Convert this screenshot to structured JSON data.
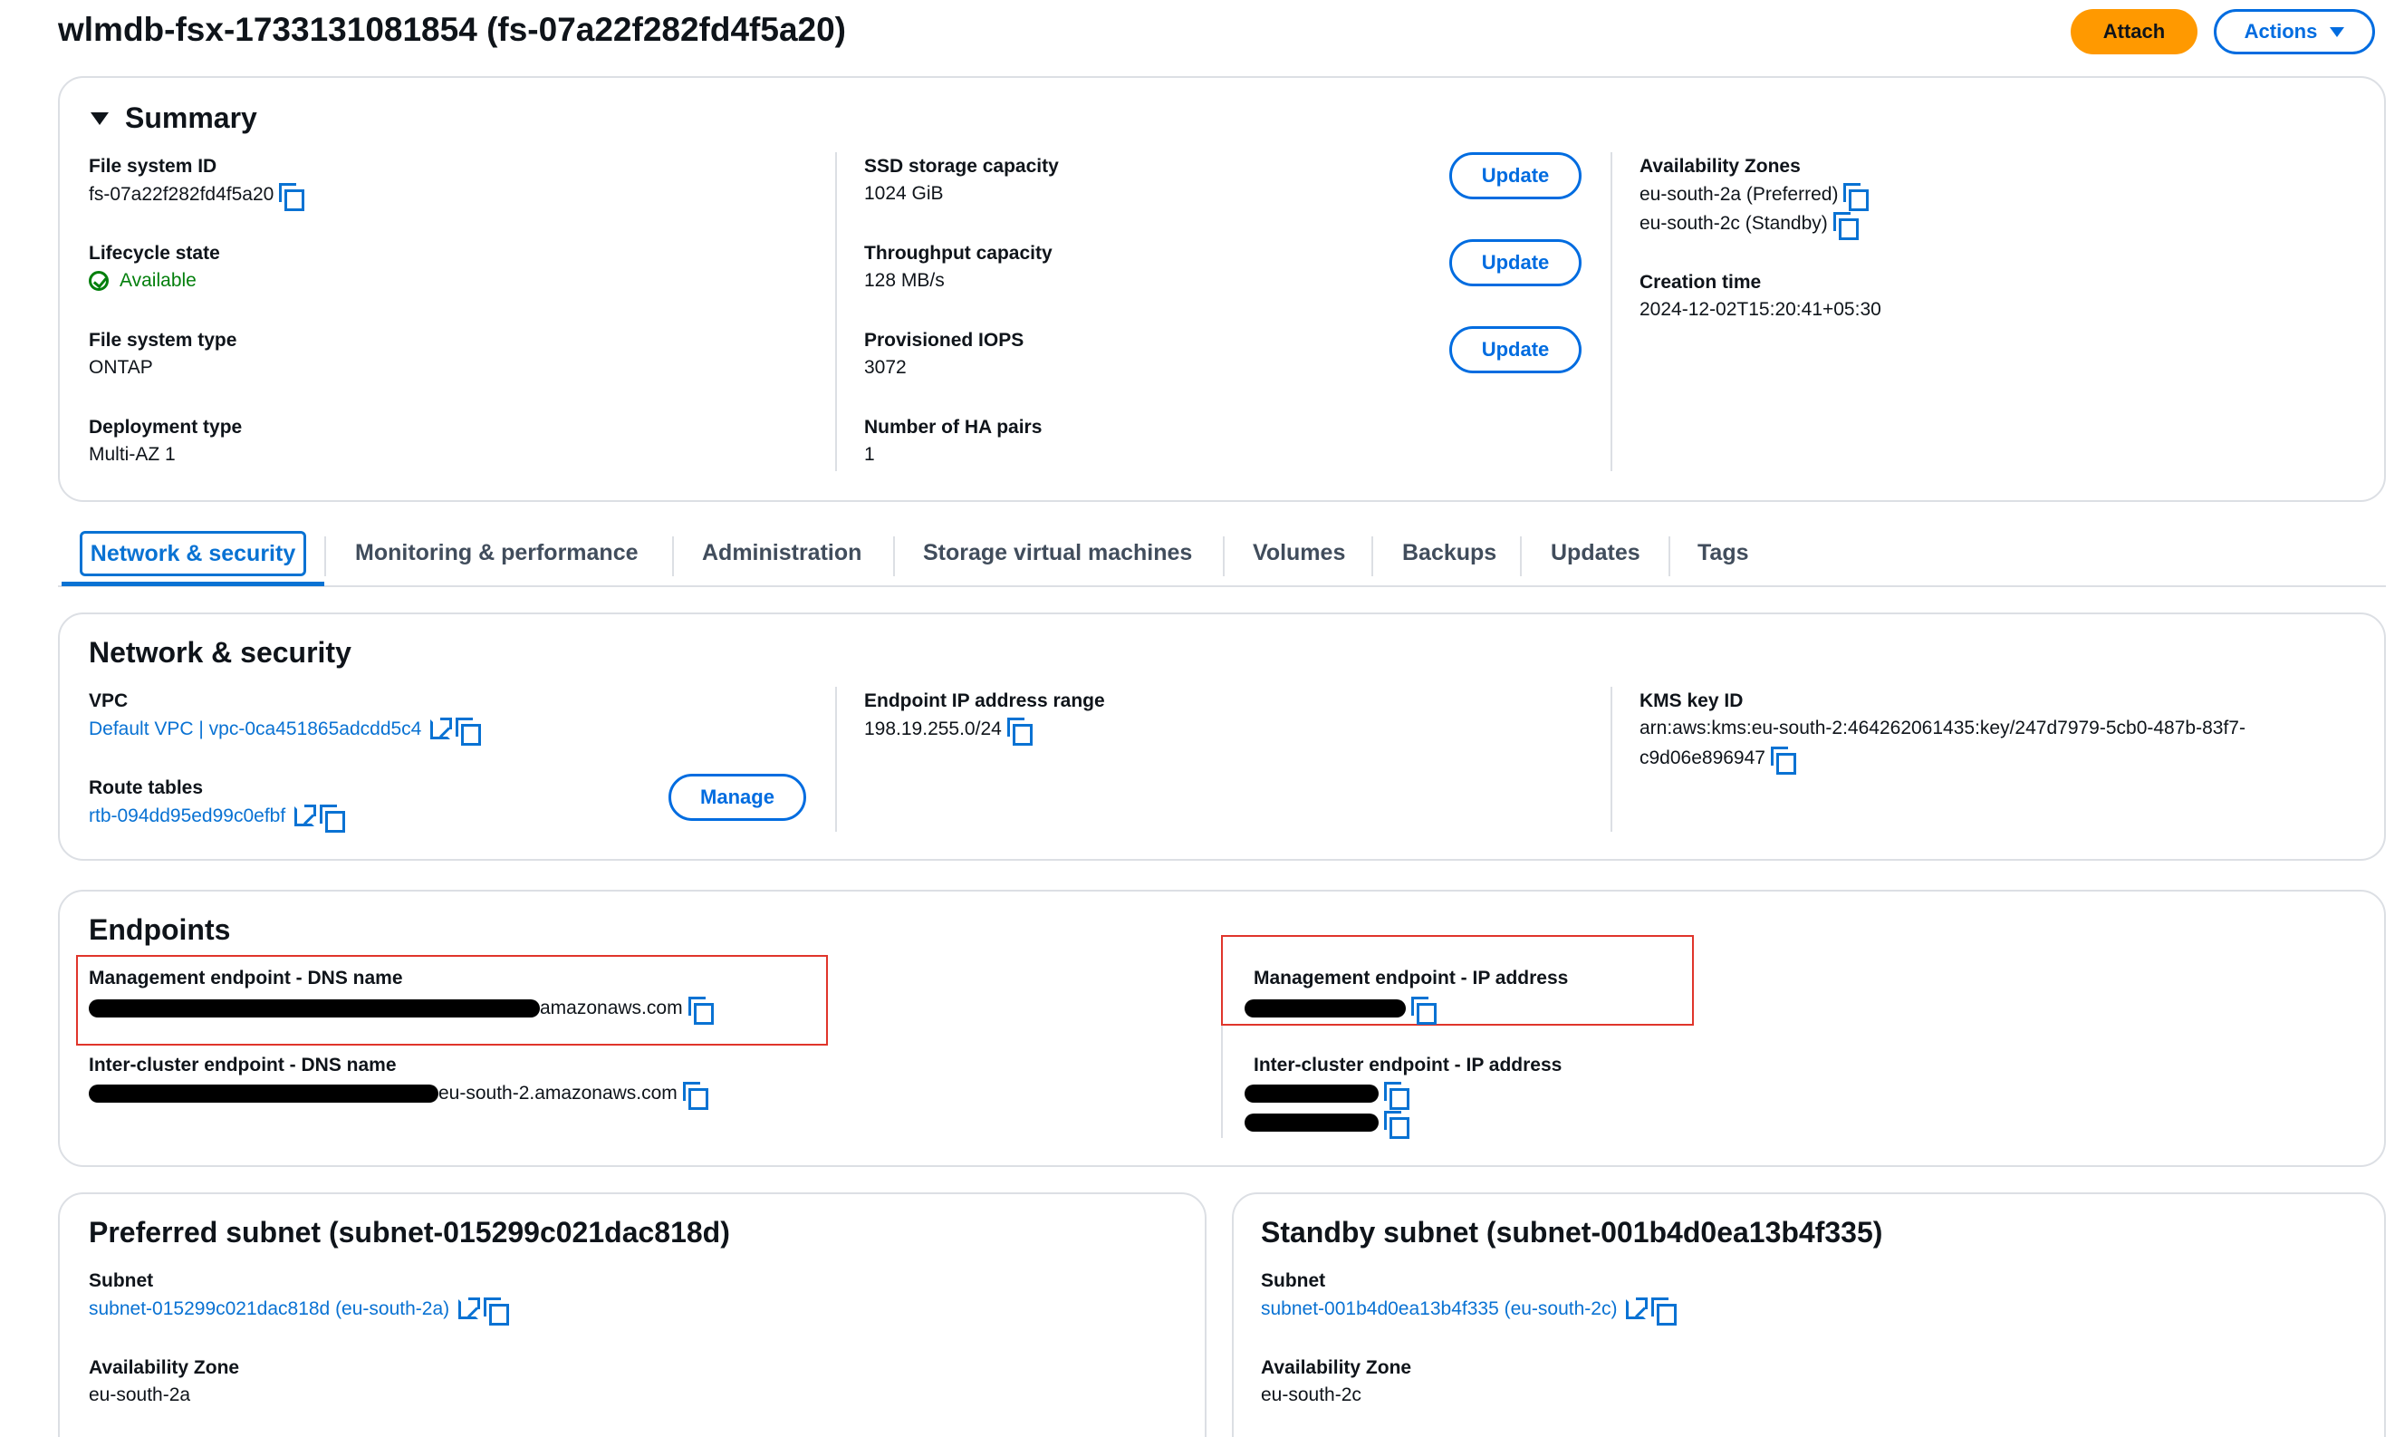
{
  "header": {
    "title": "wlmdb-fsx-1733131081854 (fs-07a22f282fd4f5a20)",
    "attach_label": "Attach",
    "actions_label": "Actions"
  },
  "summary": {
    "heading": "Summary",
    "file_system_id": {
      "label": "File system ID",
      "value": "fs-07a22f282fd4f5a20"
    },
    "lifecycle_state": {
      "label": "Lifecycle state",
      "value": "Available"
    },
    "file_system_type": {
      "label": "File system type",
      "value": "ONTAP"
    },
    "deployment_type": {
      "label": "Deployment type",
      "value": "Multi-AZ 1"
    },
    "ssd_storage_capacity": {
      "label": "SSD storage capacity",
      "value": "1024 GiB"
    },
    "throughput_capacity": {
      "label": "Throughput capacity",
      "value": "128 MB/s"
    },
    "provisioned_iops": {
      "label": "Provisioned IOPS",
      "value": "3072"
    },
    "ha_pairs": {
      "label": "Number of HA pairs",
      "value": "1"
    },
    "update_label": "Update",
    "availability_zones": {
      "label": "Availability Zones",
      "preferred": "eu-south-2a (Preferred)",
      "standby": "eu-south-2c (Standby)"
    },
    "creation_time": {
      "label": "Creation time",
      "value": "2024-12-02T15:20:41+05:30"
    }
  },
  "tabs": [
    {
      "label": "Network & security",
      "active": true
    },
    {
      "label": "Monitoring & performance"
    },
    {
      "label": "Administration"
    },
    {
      "label": "Storage virtual machines"
    },
    {
      "label": "Volumes"
    },
    {
      "label": "Backups"
    },
    {
      "label": "Updates"
    },
    {
      "label": "Tags"
    }
  ],
  "network": {
    "heading": "Network & security",
    "vpc": {
      "label": "VPC",
      "value": "Default VPC | vpc-0ca451865adcdd5c4"
    },
    "route_tables": {
      "label": "Route tables",
      "value": "rtb-094dd95ed99c0efbf"
    },
    "manage_label": "Manage",
    "endpoint_ip_range": {
      "label": "Endpoint IP address range",
      "value": "198.19.255.0/24"
    },
    "kms_key": {
      "label": "KMS key ID",
      "line1": "arn:aws:kms:eu-south-2:464262061435:key/247d7979-5cb0-487b-83f7-",
      "line2": "c9d06e896947"
    }
  },
  "endpoints": {
    "heading": "Endpoints",
    "mgmt_dns": {
      "label": "Management endpoint - DNS name",
      "suffix": "amazonaws.com"
    },
    "intercluster_dns": {
      "label": "Inter-cluster endpoint - DNS name",
      "suffix": "eu-south-2.amazonaws.com"
    },
    "mgmt_ip": {
      "label": "Management endpoint - IP address"
    },
    "intercluster_ip": {
      "label": "Inter-cluster endpoint - IP address"
    }
  },
  "preferred_subnet": {
    "heading": "Preferred subnet (subnet-015299c021dac818d)",
    "subnet_label": "Subnet",
    "subnet_value": "subnet-015299c021dac818d (eu-south-2a)",
    "az_label": "Availability Zone",
    "az_value": "eu-south-2a"
  },
  "standby_subnet": {
    "heading": "Standby subnet (subnet-001b4d0ea13b4f335)",
    "subnet_label": "Subnet",
    "subnet_value": "subnet-001b4d0ea13b4f335 (eu-south-2c)",
    "az_label": "Availability Zone",
    "az_value": "eu-south-2c"
  },
  "colors": {
    "accent": "#0972d3",
    "primary_button": "#ff9900",
    "success": "#037f0c",
    "highlight_box": "#e0352b"
  }
}
